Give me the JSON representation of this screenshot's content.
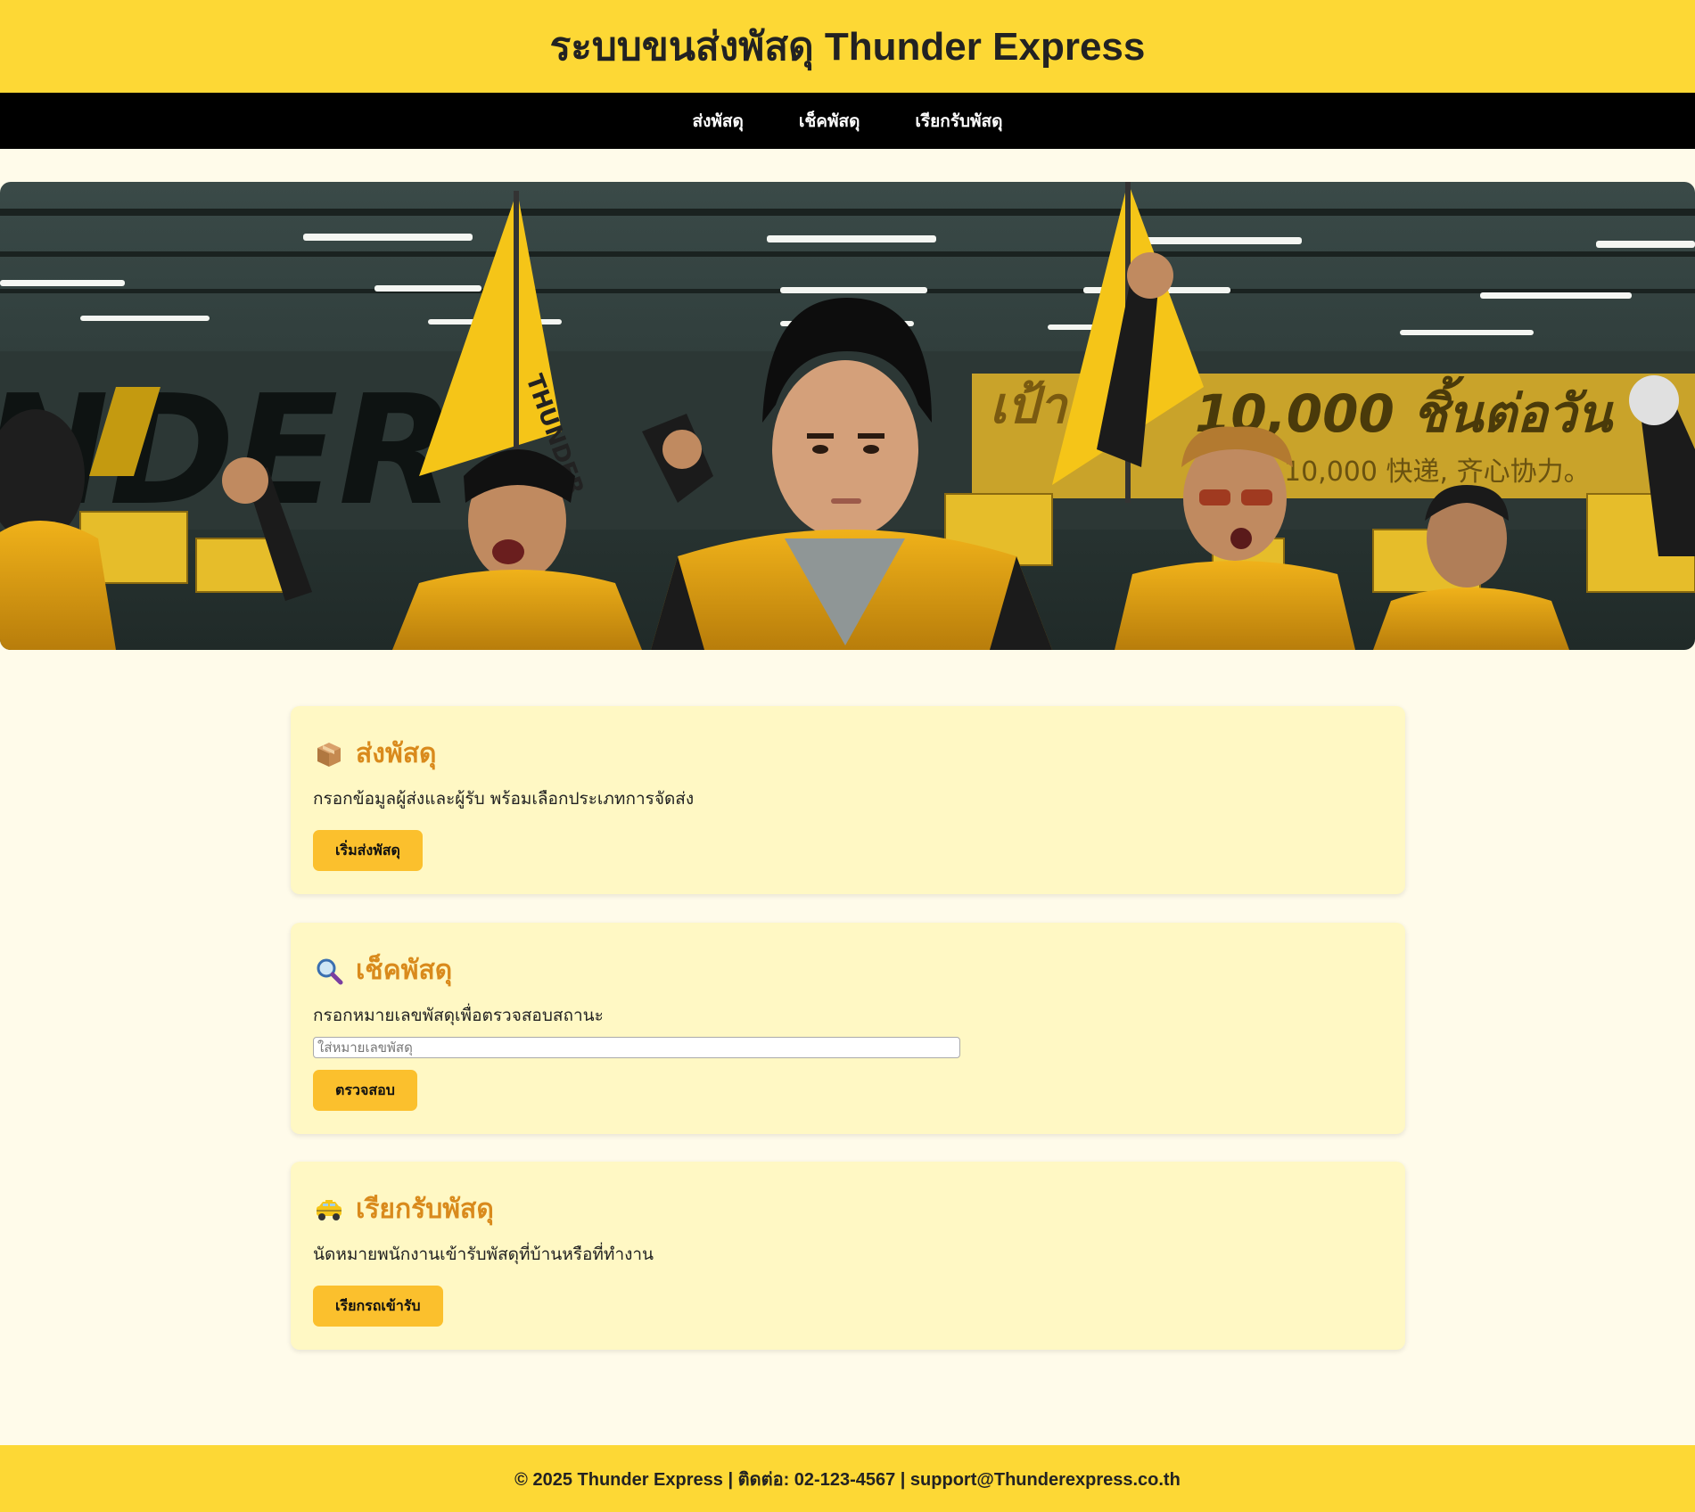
{
  "header": {
    "title": "ระบบขนส่งพัสดุ Thunder Express"
  },
  "nav": {
    "items": [
      {
        "label": "ส่งพัสดุ"
      },
      {
        "label": "เช็คพัสดุ"
      },
      {
        "label": "เรียกรับพัสดุ"
      }
    ]
  },
  "hero": {
    "banner_text": "10,000 ชิ้นต่อวัน",
    "banner_subtext": "10,000 快递, 齐心协力。",
    "banner_left": "เป้าห",
    "warehouse_text": "NDER",
    "flag_text": "THUNDER"
  },
  "cards": {
    "send": {
      "icon": "package-icon",
      "title": "ส่งพัสดุ",
      "description": "กรอกข้อมูลผู้ส่งและผู้รับ พร้อมเลือกประเภทการจัดส่ง",
      "button": "เริ่มส่งพัสดุ"
    },
    "track": {
      "icon": "magnifier-icon",
      "title": "เช็คพัสดุ",
      "description": "กรอกหมายเลขพัสดุเพื่อตรวจสอบสถานะ",
      "input_placeholder": "ใส่หมายเลขพัสดุ",
      "input_value": "",
      "button": "ตรวจสอบ"
    },
    "pickup": {
      "icon": "taxi-icon",
      "title": "เรียกรับพัสดุ",
      "description": "นัดหมายพนักงานเข้ารับพัสดุที่บ้านหรือที่ทำงาน",
      "button": "เรียกรถเข้ารับ"
    }
  },
  "footer": {
    "text": "© 2025 Thunder Express | ติดต่อ: 02-123-4567 | support@Thunderexpress.co.th"
  },
  "colors": {
    "brand_yellow": "#fdd835",
    "nav_black": "#000000",
    "card_bg": "#fff8c4",
    "title_orange": "#d98a1c",
    "button_yellow": "#fbc02d",
    "page_bg": "#fffbea"
  }
}
